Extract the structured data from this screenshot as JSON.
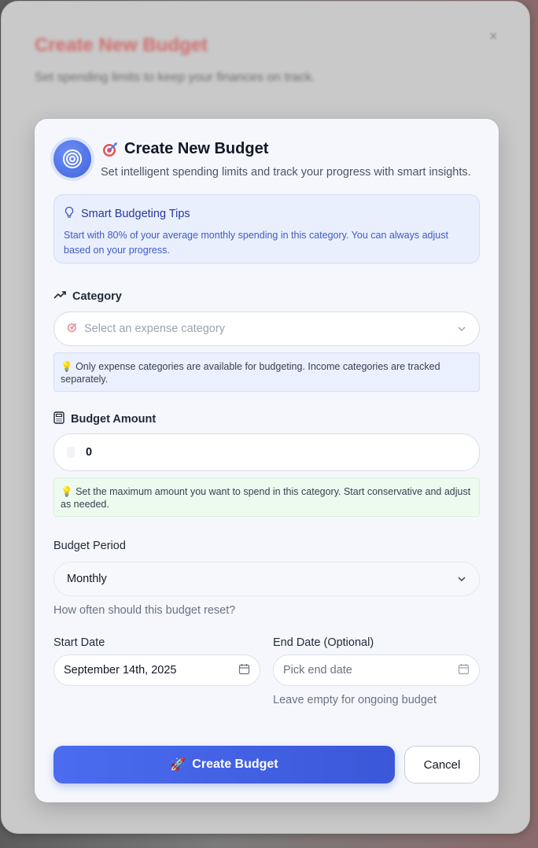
{
  "background_dialog": {
    "title": "Create New Budget",
    "subtitle": "Set spending limits to keep your finances on track.",
    "close_glyph": "×"
  },
  "dialog": {
    "title": "Create New Budget",
    "subtitle": "Set intelligent spending limits and track your progress with smart insights.",
    "header_icon": "target-icon",
    "title_emoji": "dart-target-emoji"
  },
  "tips": {
    "title": "Smart Budgeting Tips",
    "text": "Start with 80% of your average monthly spending in this category. You can always adjust based on your progress.",
    "icon": "lightbulb-icon"
  },
  "category": {
    "label": "Category",
    "placeholder": "Select an expense category",
    "hint": "Only expense categories are available for budgeting. Income categories are tracked separately.",
    "hint_icon": "💡"
  },
  "amount": {
    "label": "Budget Amount",
    "value": "0",
    "hint": "Set the maximum amount you want to spend in this category. Start conservative and adjust as needed.",
    "hint_icon": "💡"
  },
  "period": {
    "label": "Budget Period",
    "value": "Monthly",
    "help": "How often should this budget reset?"
  },
  "start_date": {
    "label": "Start Date",
    "value": "September 14th, 2025"
  },
  "end_date": {
    "label": "End Date (Optional)",
    "placeholder": "Pick end date",
    "help": "Leave empty for ongoing budget"
  },
  "actions": {
    "create_label": "Create Budget",
    "create_emoji": "🚀",
    "cancel_label": "Cancel"
  },
  "colors": {
    "primary": "#4361e6",
    "tips_bg": "#eaeffd",
    "green_hint_bg": "#edfbef"
  }
}
